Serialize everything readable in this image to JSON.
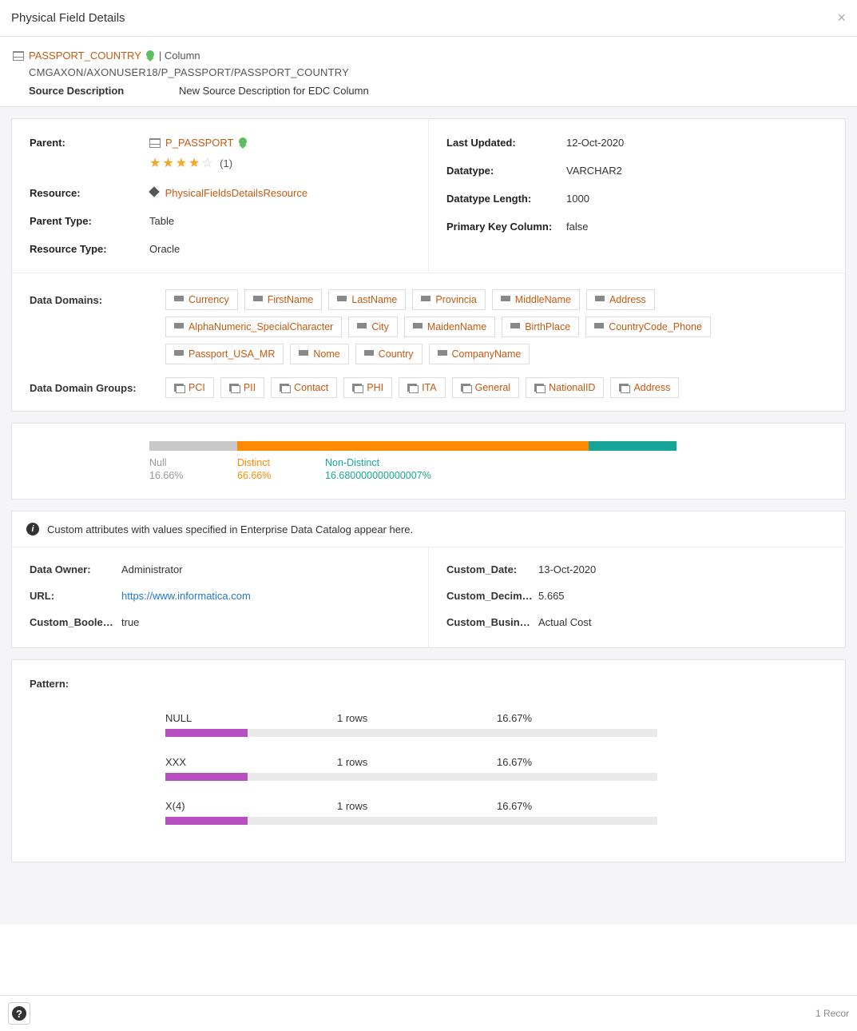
{
  "title": "Physical Field Details",
  "header": {
    "name": "PASSPORT_COUNTRY",
    "type_label": "| Column",
    "path": "CMGAXON/AXONUSER18/P_PASSPORT/PASSPORT_COUNTRY",
    "source_desc_label": "Source Description",
    "source_desc_value": "New Source Description for EDC Column"
  },
  "details_left": {
    "parent_label": "Parent:",
    "parent_value": "P_PASSPORT",
    "rating_count": "(1)",
    "resource_label": "Resource:",
    "resource_value": "PhysicalFieldsDetailsResource",
    "parent_type_label": "Parent Type:",
    "parent_type_value": "Table",
    "resource_type_label": "Resource Type:",
    "resource_type_value": "Oracle"
  },
  "details_right": {
    "last_updated_label": "Last Updated:",
    "last_updated_value": "12-Oct-2020",
    "datatype_label": "Datatype:",
    "datatype_value": "VARCHAR2",
    "datatype_len_label": "Datatype Length:",
    "datatype_len_value": "1000",
    "pk_label": "Primary Key Column:",
    "pk_value": "false"
  },
  "domains": {
    "label": "Data Domains:",
    "items": [
      "Currency",
      "FirstName",
      "LastName",
      "Provincia",
      "MiddleName",
      "Address",
      "AlphaNumeric_SpecialCharacter",
      "City",
      "MaidenName",
      "BirthPlace",
      "CountryCode_Phone",
      "Passport_USA_MR",
      "Nome",
      "Country",
      "CompanyName"
    ]
  },
  "domain_groups": {
    "label": "Data Domain Groups:",
    "items": [
      "PCI",
      "PII",
      "Contact",
      "PHI",
      "ITA",
      "General",
      "NationalID",
      "Address"
    ]
  },
  "distribution": {
    "null_label": "Null",
    "null_pct": "16.66%",
    "distinct_label": "Distinct",
    "distinct_pct": "66.66%",
    "nondistinct_label": "Non-Distinct",
    "nondistinct_pct": "16.680000000000007%",
    "null_w": 16.66,
    "distinct_w": 66.66,
    "nondistinct_w": 16.68
  },
  "custom_info": "Custom attributes with values specified in Enterprise Data Catalog appear here.",
  "custom_left": {
    "owner_label": "Data Owner:",
    "owner_value": "Administrator",
    "url_label": "URL:",
    "url_value": "https://www.informatica.com",
    "bool_label": "Custom_Boole…",
    "bool_value": "true"
  },
  "custom_right": {
    "date_label": "Custom_Date:",
    "date_value": "13-Oct-2020",
    "decim_label": "Custom_Decim…",
    "decim_value": "5.665",
    "busin_label": "Custom_Busin…",
    "busin_value": "Actual Cost"
  },
  "pattern": {
    "label": "Pattern:",
    "items": [
      {
        "name": "NULL",
        "rows": "1 rows",
        "pct": "16.67%",
        "w": 16.67
      },
      {
        "name": "XXX",
        "rows": "1 rows",
        "pct": "16.67%",
        "w": 16.67
      },
      {
        "name": "X(4)",
        "rows": "1 rows",
        "pct": "16.67%",
        "w": 16.67
      }
    ]
  },
  "footer_text": "1 Recor"
}
